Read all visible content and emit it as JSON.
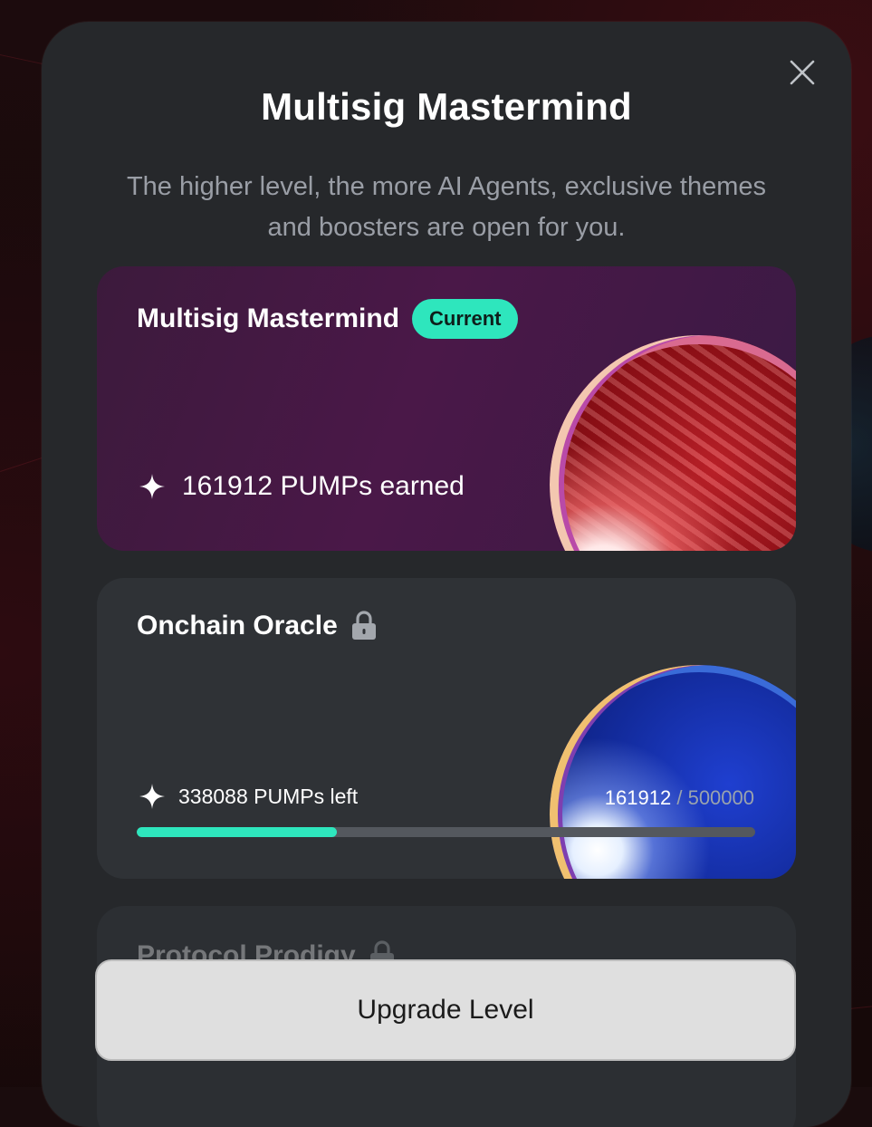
{
  "modal": {
    "title": "Multisig Mastermind",
    "subtitle": "The higher level, the more AI Agents, exclusive themes and boosters are open for you."
  },
  "levels": [
    {
      "name": "Multisig Mastermind",
      "badge": "Current",
      "stat_text": "161912 PUMPs earned",
      "coin_color": "red"
    },
    {
      "name": "Onchain Oracle",
      "locked": true,
      "stat_text": "338088 PUMPs left",
      "progress_current": "161912",
      "progress_separator": "/",
      "progress_total": "500000",
      "progress_fraction": 0.323824,
      "coin_color": "blue"
    },
    {
      "name": "Protocol Prodigy",
      "locked": true
    }
  ],
  "upgrade_button": {
    "label": "Upgrade Level"
  },
  "icons": {
    "close": "close-icon",
    "sparkle": "sparkle-icon",
    "lock": "lock-icon"
  },
  "colors": {
    "accent": "#2ee6bd",
    "modal_bg": "#26282b",
    "current_card_bg": "#4a1848",
    "locked_card_bg": "#2f3236",
    "button_bg": "#dfdfdf"
  }
}
